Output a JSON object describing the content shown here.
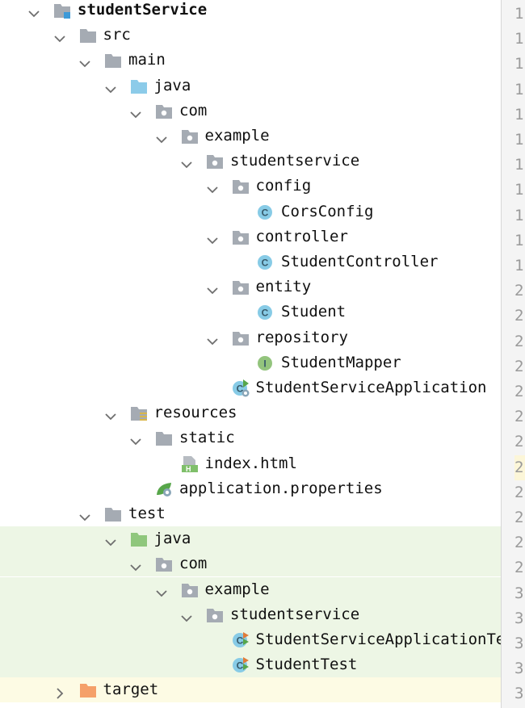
{
  "tree": {
    "items": [
      {
        "label": "studentService",
        "depth": 0,
        "expanded": true,
        "icon": "module-folder-icon",
        "bold": true
      },
      {
        "label": "src",
        "depth": 1,
        "expanded": true,
        "icon": "folder-icon"
      },
      {
        "label": "main",
        "depth": 2,
        "expanded": true,
        "icon": "folder-icon"
      },
      {
        "label": "java",
        "depth": 3,
        "expanded": true,
        "icon": "source-root-folder-icon"
      },
      {
        "label": "com",
        "depth": 4,
        "expanded": true,
        "icon": "package-icon"
      },
      {
        "label": "example",
        "depth": 5,
        "expanded": true,
        "icon": "package-icon"
      },
      {
        "label": "studentservice",
        "depth": 6,
        "expanded": true,
        "icon": "package-icon"
      },
      {
        "label": "config",
        "depth": 7,
        "expanded": true,
        "icon": "package-icon"
      },
      {
        "label": "CorsConfig",
        "depth": 8,
        "icon": "java-class-icon"
      },
      {
        "label": "controller",
        "depth": 7,
        "expanded": true,
        "icon": "package-icon"
      },
      {
        "label": "StudentController",
        "depth": 8,
        "icon": "java-class-icon"
      },
      {
        "label": "entity",
        "depth": 7,
        "expanded": true,
        "icon": "package-icon"
      },
      {
        "label": "Student",
        "depth": 8,
        "icon": "java-class-icon"
      },
      {
        "label": "repository",
        "depth": 7,
        "expanded": true,
        "icon": "package-icon"
      },
      {
        "label": "StudentMapper",
        "depth": 8,
        "icon": "java-interface-icon"
      },
      {
        "label": "StudentServiceApplication",
        "depth": 7,
        "icon": "spring-boot-class-icon"
      },
      {
        "label": "resources",
        "depth": 3,
        "expanded": true,
        "icon": "resources-folder-icon"
      },
      {
        "label": "static",
        "depth": 4,
        "expanded": true,
        "icon": "folder-icon"
      },
      {
        "label": "index.html",
        "depth": 5,
        "icon": "html-file-icon"
      },
      {
        "label": "application.properties",
        "depth": 4,
        "icon": "spring-properties-icon"
      },
      {
        "label": "test",
        "depth": 2,
        "expanded": true,
        "icon": "folder-icon"
      },
      {
        "label": "java",
        "depth": 3,
        "expanded": true,
        "icon": "test-root-folder-icon",
        "highlight": "test"
      },
      {
        "label": "com",
        "depth": 4,
        "expanded": true,
        "icon": "package-icon",
        "highlight": "test"
      },
      {
        "label": "example",
        "depth": 5,
        "expanded": true,
        "icon": "package-icon",
        "highlight": "test"
      },
      {
        "label": "studentservice",
        "depth": 6,
        "expanded": true,
        "icon": "package-icon",
        "highlight": "test"
      },
      {
        "label": "StudentServiceApplicationTe",
        "depth": 7,
        "icon": "test-class-icon",
        "highlight": "test"
      },
      {
        "label": "StudentTest",
        "depth": 7,
        "icon": "test-class-icon",
        "highlight": "test"
      },
      {
        "label": "target",
        "depth": 1,
        "expanded": false,
        "icon": "excluded-folder-icon",
        "highlight": "target"
      }
    ]
  },
  "gutter": {
    "numbers": [
      "1",
      "1",
      "1",
      "1",
      "1",
      "1",
      "1",
      "1",
      "1",
      "1",
      "1",
      "2",
      "2",
      "2",
      "2",
      "2",
      "2",
      "2",
      "2",
      "2",
      "2",
      "2",
      "2",
      "3",
      "3",
      "3",
      "3",
      "3"
    ],
    "current_line": "2"
  },
  "colors": {
    "folder": "#a5abb3",
    "source_root": "#8ccbe9",
    "test_root": "#8fc77c",
    "excluded": "#f5a069",
    "class_badge": "#87cbe6",
    "interface_badge": "#93c47d",
    "test_highlight": "#edf6e5",
    "target_highlight": "#fdfbe4"
  }
}
